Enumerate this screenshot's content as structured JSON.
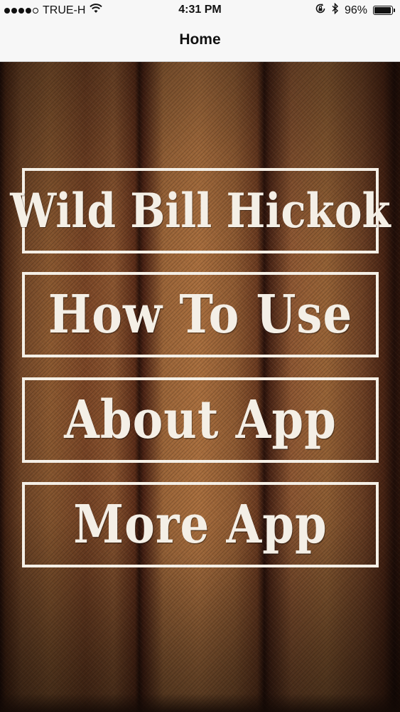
{
  "status_bar": {
    "carrier": "TRUE-H",
    "time": "4:31 PM",
    "battery_percent_label": "96%",
    "battery_level": 0.96
  },
  "nav": {
    "title": "Home"
  },
  "menu": {
    "title_label": "Wild Bill Hickok",
    "items": [
      {
        "label": "How To Use"
      },
      {
        "label": "About App"
      },
      {
        "label": "More App"
      }
    ]
  },
  "colors": {
    "bar_background": "#f7f7f7",
    "frame_and_text": "#f4efe6",
    "wood_base": "#8a5530"
  },
  "icons": [
    "signal-dots-icon",
    "wifi-icon",
    "rotation-lock-icon",
    "bluetooth-icon",
    "battery-icon"
  ]
}
